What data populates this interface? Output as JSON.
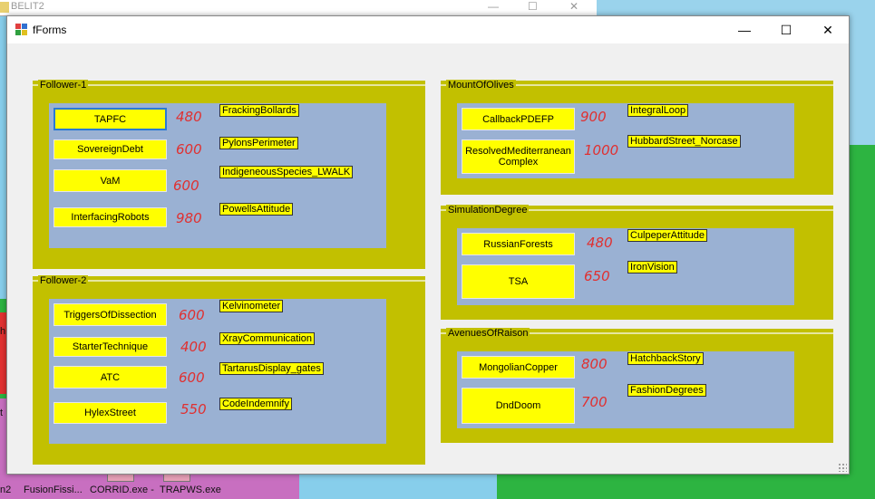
{
  "background_window": {
    "title": "BELIT2",
    "min": "—",
    "max": "☐",
    "close": "✕"
  },
  "desktop": {
    "taskbar_items": [
      "n2",
      "FusionFissi...",
      "CORRID.exe -",
      "TRAPWS.exe"
    ],
    "side_labels": [
      "h",
      "t"
    ]
  },
  "form": {
    "title": "fForms",
    "min": "—",
    "max": "☐",
    "close": "✕"
  },
  "groups": [
    {
      "title": "Follower-1",
      "buttons": [
        "TAPFC",
        "SovereignDebt",
        "VaM",
        "InterfacingRobots"
      ],
      "numbers": [
        "480",
        "600",
        "600",
        "980"
      ],
      "tags": [
        "FrackingBollards",
        "PylonsPerimeter",
        "IndigeneousSpecies_LWALK",
        "PowellsAttitude"
      ]
    },
    {
      "title": "Follower-2",
      "buttons": [
        "TriggersOfDissection",
        "StarterTechnique",
        "ATC",
        "HylexStreet"
      ],
      "numbers": [
        "600",
        "400",
        "600",
        "550"
      ],
      "tags": [
        "Kelvinometer",
        "XrayCommunication",
        "TartarusDisplay_gates",
        "CodeIndemnify"
      ]
    },
    {
      "title": "MountOfOlives",
      "buttons": [
        "CallbackPDEFP",
        "ResolvedMediterranean Complex"
      ],
      "numbers": [
        "900",
        "1000"
      ],
      "tags": [
        "IntegralLoop",
        "HubbardStreet_Norcase"
      ]
    },
    {
      "title": "SimulationDegree",
      "buttons": [
        "RussianForests",
        "TSA"
      ],
      "numbers": [
        "480",
        "650"
      ],
      "tags": [
        "CulpeperAttitude",
        "IronVision"
      ]
    },
    {
      "title": "AvenuesOfRaison",
      "buttons": [
        "MongolianCopper",
        "DndDoom"
      ],
      "numbers": [
        "800",
        "700"
      ],
      "tags": [
        "HatchbackStory",
        "FashionDegrees"
      ]
    }
  ],
  "colors": {
    "group_bg": "#c2c000",
    "panel_bg": "#9ab1d3",
    "button_bg": "#ffff00",
    "number_color": "#e03030"
  }
}
